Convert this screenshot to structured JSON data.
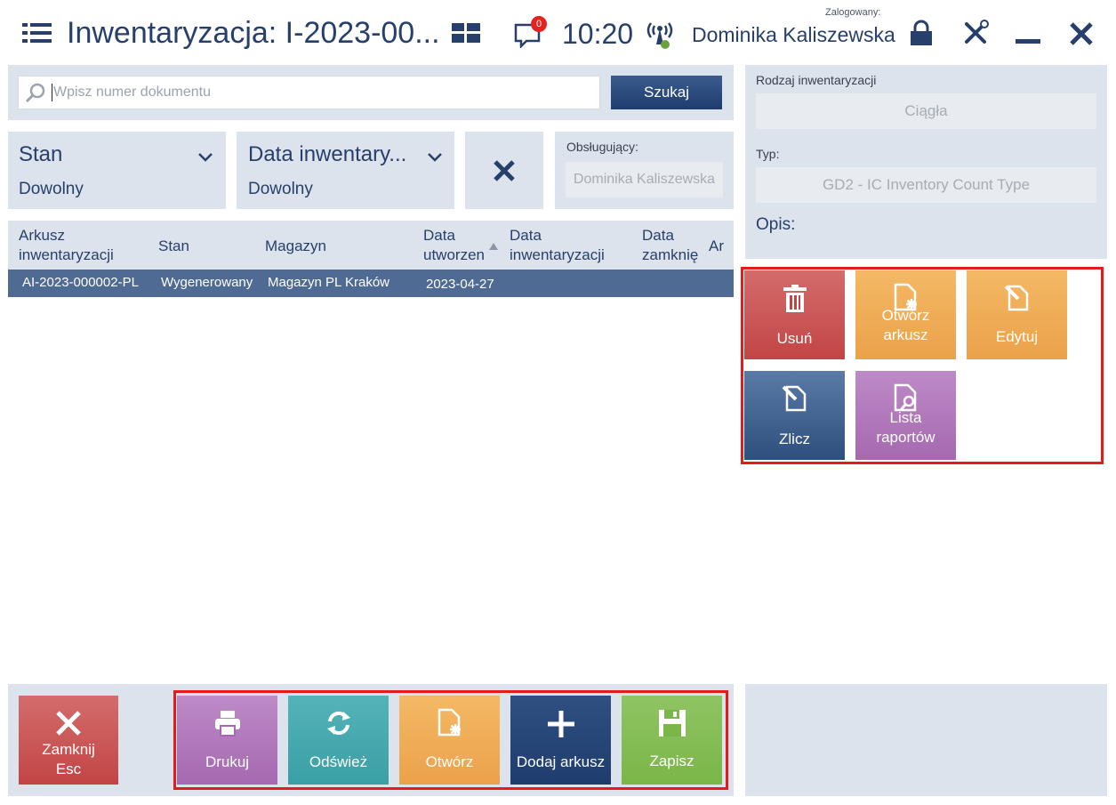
{
  "header": {
    "title": "Inwentaryzacja: I-2023-00...",
    "notification_count": "0",
    "time": "10:20",
    "logged_label": "Zalogowany:",
    "user_name": "Dominika Kaliszewska"
  },
  "search": {
    "placeholder": "Wpisz numer dokumentu",
    "button_label": "Szukaj"
  },
  "filters": {
    "stan_title": "Stan",
    "stan_value": "Dowolny",
    "data_title": "Data inwentary...",
    "data_value": "Dowolny",
    "obslugujacy_label": "Obsługujący:",
    "obslugujacy_value": "Dominika Kaliszewska"
  },
  "table": {
    "columns": [
      "Arkusz inwentaryzacji",
      "Stan",
      "Magazyn",
      "Data utworzen",
      "Data inwentaryzacji",
      "Data zamknię",
      "Ar"
    ],
    "rows": [
      {
        "arkusz": "AI-2023-000002-PL",
        "stan": "Wygenerowany",
        "magazyn": "Magazyn PL Kraków",
        "data_utworzenia": "2023-04-27"
      }
    ]
  },
  "details": {
    "rodzaj_label": "Rodzaj inwentaryzacji",
    "rodzaj_value": "Ciągła",
    "typ_label": "Typ:",
    "typ_value": "GD2 - IC Inventory Count Type",
    "opis_label": "Opis:"
  },
  "side_actions": {
    "usun": "Usuń",
    "otworz_arkusz_1": "Otwórz",
    "otworz_arkusz_2": "arkusz",
    "edytuj": "Edytuj",
    "zlicz": "Zlicz",
    "lista_raportow_1": "Lista",
    "lista_raportow_2": "raportów"
  },
  "bottom_actions": {
    "zamknij_1": "Zamknij",
    "zamknij_2": "Esc",
    "drukuj": "Drukuj",
    "odswiez": "Odśwież",
    "otworz": "Otwórz",
    "dodaj_arkusz": "Dodaj arkusz",
    "zapisz": "Zapisz"
  },
  "colors": {
    "red": "#c94b4b",
    "orange": "#f0ad4e",
    "blue_dark": "#2b4a7a",
    "purple": "#a569b0",
    "teal": "#3a9fa5",
    "green": "#7ab648",
    "highlight": "#e51b1b"
  },
  "icons": [
    "menu-icon",
    "tiles-icon",
    "chat-icon",
    "signal-icon",
    "lock-icon",
    "tools-icon",
    "minimize-icon",
    "close-icon",
    "search-icon",
    "chevron-down-icon",
    "clear-icon",
    "trash-icon",
    "open-doc-icon",
    "edit-doc-icon",
    "count-icon",
    "report-icon",
    "print-icon",
    "refresh-icon",
    "plus-icon",
    "save-icon",
    "sort-asc-icon"
  ]
}
